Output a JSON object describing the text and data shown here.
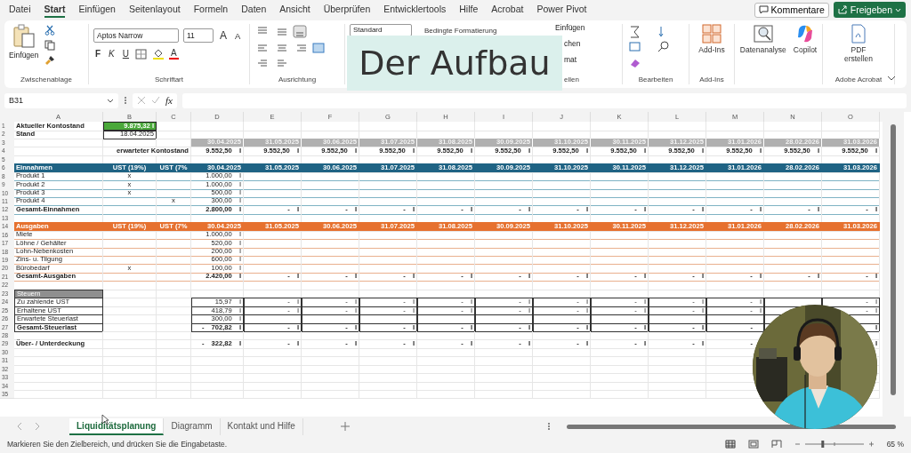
{
  "menu": {
    "tabs": [
      {
        "label": "Datei",
        "selected": false
      },
      {
        "label": "Start",
        "selected": true
      },
      {
        "label": "Einfügen",
        "selected": false
      },
      {
        "label": "Seitenlayout",
        "selected": false
      },
      {
        "label": "Formeln",
        "selected": false
      },
      {
        "label": "Daten",
        "selected": false
      },
      {
        "label": "Ansicht",
        "selected": false
      },
      {
        "label": "Überprüfen",
        "selected": false
      },
      {
        "label": "Entwicklertools",
        "selected": false
      },
      {
        "label": "Hilfe",
        "selected": false
      },
      {
        "label": "Acrobat",
        "selected": false
      },
      {
        "label": "Power Pivot",
        "selected": false
      }
    ],
    "comments_button": "Kommentare",
    "share_button": "Freigeben"
  },
  "ribbon": {
    "clipboard": {
      "paste": "Einfügen",
      "label": "Zwischenablage"
    },
    "font": {
      "name": "Aptos Narrow",
      "size": "11",
      "grow": "A",
      "shrink": "A",
      "bold": "F",
      "italic": "K",
      "underline": "U",
      "font_color_button": "A",
      "label": "Schriftart"
    },
    "alignment": {
      "label": "Ausrichtung"
    },
    "number": {
      "format": "Standard"
    },
    "styles": {
      "conditional": "Bedingte Formatierung"
    },
    "cells": {
      "items": [
        "Einfügen",
        "chen",
        "mat"
      ],
      "label": "ellen"
    },
    "editing": {
      "label": "Bearbeiten"
    },
    "addins": {
      "button": "Add-Ins",
      "label": "Add-Ins"
    },
    "analysis": {
      "buttons": [
        "Datenanalyse",
        "Copilot"
      ]
    },
    "acrobat": {
      "button": "PDF erstellen",
      "label": "Adobe Acrobat"
    }
  },
  "overlay": {
    "title": "Der Aufbau"
  },
  "formula_bar": {
    "name_box": "B31",
    "fx": "fx"
  },
  "sheet": {
    "columns": [
      "A",
      "B",
      "C",
      "D",
      "E",
      "F",
      "G",
      "H",
      "I",
      "J",
      "K",
      "L",
      "M",
      "N",
      "O"
    ],
    "rows": [
      {
        "num": "1",
        "kind": "current-balance",
        "cells": {
          "A": "Aktueller Kontostand",
          "B": "9.875,32 I"
        }
      },
      {
        "num": "2",
        "kind": "as-of",
        "cells": {
          "A": "Stand",
          "B": "18.04.2025"
        }
      },
      {
        "num": "3",
        "kind": "dates",
        "cells": {
          "D": "30.04.2025",
          "E": "31.05.2025",
          "F": "30.06.2025",
          "G": "31.07.2025",
          "H": "31.08.2025",
          "I": "30.09.2025",
          "J": "31.10.2025",
          "K": "30.11.2025",
          "L": "31.12.2025",
          "M": "31.01.2026",
          "N": "28.02.2026",
          "O": "31.03.2026"
        }
      },
      {
        "num": "4",
        "kind": "balance",
        "cells": {
          "B": "erwarteter Kontostand",
          "D": "9.552,50 I",
          "E": "9.552,50 I",
          "F": "9.552,50 I",
          "G": "9.552,50 I",
          "H": "9.552,50 I",
          "I": "9.552,50 I",
          "J": "9.552,50 I",
          "K": "9.552,50 I",
          "L": "9.552,50 I",
          "M": "9.552,50 I",
          "N": "9.552,50 I",
          "O": "9.552,50 I"
        }
      },
      {
        "num": "5",
        "kind": "blank",
        "cells": {}
      },
      {
        "num": "6",
        "kind": "income-header",
        "cells": {
          "A": "Einnahmen",
          "B": "UST (19%)",
          "C": "UST (7%",
          "D": "30.04.2025",
          "E": "31.05.2025",
          "F": "30.06.2025",
          "G": "31.07.2025",
          "H": "31.08.2025",
          "I": "30.09.2025",
          "J": "31.10.2025",
          "K": "30.11.2025",
          "L": "31.12.2025",
          "M": "31.01.2026",
          "N": "28.02.2026",
          "O": "31.03.2026"
        }
      },
      {
        "num": "8",
        "kind": "income-item",
        "cells": {
          "A": "Produkt 1",
          "B": "x",
          "D": "1.000,00 I"
        }
      },
      {
        "num": "9",
        "kind": "income-item",
        "cells": {
          "A": "Produkt 2",
          "B": "x",
          "D": "1.000,00 I"
        }
      },
      {
        "num": "10",
        "kind": "income-item",
        "cells": {
          "A": "Produkt 3",
          "B": "x",
          "D": "500,00 I"
        }
      },
      {
        "num": "11",
        "kind": "income-item",
        "cells": {
          "A": "Produkt 4",
          "C": "x",
          "D": "300,00 I"
        }
      },
      {
        "num": "12",
        "kind": "income-total",
        "cells": {
          "A": "Gesamt-Einnahmen",
          "D": "2.800,00 I",
          "E": "- I",
          "F": "- I",
          "G": "- I",
          "H": "- I",
          "I": "- I",
          "J": "- I",
          "K": "- I",
          "L": "- I",
          "M": "- I",
          "N": "- I",
          "O": "- I"
        }
      },
      {
        "num": "13",
        "kind": "blank",
        "cells": {}
      },
      {
        "num": "14",
        "kind": "expense-header",
        "cells": {
          "A": "Ausgaben",
          "B": "UST (19%)",
          "C": "UST (7%",
          "D": "30.04.2025",
          "E": "31.05.2025",
          "F": "30.06.2025",
          "G": "31.07.2025",
          "H": "31.08.2025",
          "I": "30.09.2025",
          "J": "31.10.2025",
          "K": "30.11.2025",
          "L": "31.12.2025",
          "M": "31.01.2026",
          "N": "28.02.2026",
          "O": "31.03.2026"
        }
      },
      {
        "num": "16",
        "kind": "expense-item",
        "cells": {
          "A": "Miete",
          "D": "1.000,00 I"
        }
      },
      {
        "num": "17",
        "kind": "expense-item",
        "cells": {
          "A": "Löhne / Gehälter",
          "D": "520,00 I"
        }
      },
      {
        "num": "18",
        "kind": "expense-item",
        "cells": {
          "A": "Lohn-Nebenkosten",
          "D": "200,00 I"
        }
      },
      {
        "num": "19",
        "kind": "expense-item",
        "cells": {
          "A": "Zins- u. Tilgung",
          "D": "600,00 I"
        }
      },
      {
        "num": "20",
        "kind": "expense-item",
        "cells": {
          "A": "Bürobedarf",
          "B": "x",
          "D": "100,00 I"
        }
      },
      {
        "num": "21",
        "kind": "expense-total",
        "cells": {
          "A": "Gesamt-Ausgaben",
          "D": "2.420,00 I",
          "E": "- I",
          "F": "- I",
          "G": "- I",
          "H": "- I",
          "I": "- I",
          "J": "- I",
          "K": "- I",
          "L": "- I",
          "M": "- I",
          "N": "- I",
          "O": "- I"
        }
      },
      {
        "num": "22",
        "kind": "blank",
        "cells": {}
      },
      {
        "num": "23",
        "kind": "tax-header",
        "cells": {
          "A": "Steuern"
        }
      },
      {
        "num": "24",
        "kind": "tax-item",
        "cells": {
          "A": "Zu zahlende UST",
          "D": "15,97 I",
          "E": "- I",
          "F": "- I",
          "G": "- I",
          "H": "- I",
          "I": "- I",
          "J": "- I",
          "K": "- I",
          "L": "- I",
          "M": "- I",
          "O": "- I"
        }
      },
      {
        "num": "25",
        "kind": "tax-item",
        "cells": {
          "A": "Erhaltene UST",
          "D": "418,79 I",
          "E": "- I",
          "F": "- I",
          "G": "- I",
          "H": "- I",
          "I": "- I",
          "J": "- I",
          "K": "- I",
          "L": "- I",
          "M": "- I",
          "O": "- I"
        }
      },
      {
        "num": "26",
        "kind": "tax-item",
        "cells": {
          "A": "Erwartete Steuerlast",
          "D": "300,00 I"
        }
      },
      {
        "num": "27",
        "kind": "tax-total",
        "cells": {
          "A": "Gesamt-Steuerlast",
          "D": "- 702,82 I",
          "E": "- I",
          "F": "- I",
          "G": "- I",
          "H": "- I",
          "I": "- I",
          "J": "- I",
          "K": "- I",
          "L": "- I",
          "M": {
            "text": "-",
            "symbol_hidden": true
          },
          "O": "I"
        }
      },
      {
        "num": "28",
        "kind": "blank",
        "cells": {}
      },
      {
        "num": "29",
        "kind": "result",
        "cells": {
          "A": "Über- / Unterdeckung",
          "D": "- 322,82 I",
          "E": "- I",
          "F": "- I",
          "G": "- I",
          "H": "- I",
          "I": "- I",
          "J": "- I",
          "K": "- I",
          "L": "- I",
          "M": {
            "text": "-",
            "symbol_hidden": true
          },
          "O": "I"
        }
      },
      {
        "num": "30",
        "kind": "blank",
        "cells": {}
      },
      {
        "num": "31",
        "kind": "blank",
        "cells": {}
      },
      {
        "num": "32",
        "kind": "blank",
        "cells": {}
      },
      {
        "num": "33",
        "kind": "blank",
        "cells": {}
      },
      {
        "num": "34",
        "kind": "blank",
        "cells": {}
      },
      {
        "num": "35",
        "kind": "blank",
        "cells": {}
      }
    ]
  },
  "sheet_tabs": [
    {
      "label": "Liquiditätsplanung",
      "selected": true
    },
    {
      "label": "Diagramm",
      "selected": false
    },
    {
      "label": "Kontakt und Hilfe",
      "selected": false
    }
  ],
  "status_bar": {
    "message": "Markieren Sie den Zielbereich, und drücken Sie die Eingabetaste.",
    "zoom_slider": {
      "level": 0.3
    },
    "zoom": "65 %"
  }
}
